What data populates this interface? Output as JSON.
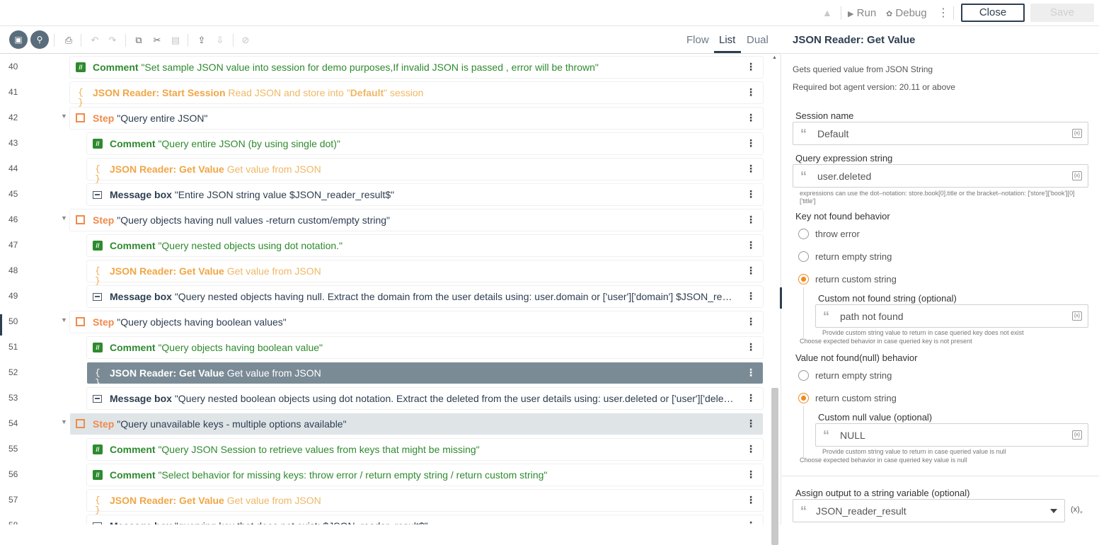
{
  "header": {
    "run_label": "Run",
    "debug_label": "Debug",
    "close_label": "Close",
    "save_label": "Save"
  },
  "view_tabs": [
    "Flow",
    "List",
    "Dual"
  ],
  "active_view": "List",
  "rows": [
    {
      "n": "40",
      "indent": 0,
      "kind": "cmt",
      "kw": "Comment",
      "text": " \"Set sample JSON value into session for demo purposes,If invalid JSON is passed , error will be thrown\""
    },
    {
      "n": "41",
      "indent": 0,
      "kind": "json",
      "kw": "JSON Reader: Start Session",
      "text": " Read JSON and store into \"",
      "bold": "Default",
      "tail": "\" session"
    },
    {
      "n": "42",
      "indent": 0,
      "kind": "step",
      "kw": "Step",
      "text": " \"Query entire JSON\"",
      "caret": true
    },
    {
      "n": "43",
      "indent": 1,
      "kind": "cmt",
      "kw": "Comment",
      "text": " \"Query entire JSON (by using single dot)\""
    },
    {
      "n": "44",
      "indent": 1,
      "kind": "json",
      "kw": "JSON Reader: Get Value",
      "text": " Get value from JSON"
    },
    {
      "n": "45",
      "indent": 1,
      "kind": "msg",
      "kw": "Message box",
      "text": " \"Entire JSON string value $JSON_reader_result$\""
    },
    {
      "n": "46",
      "indent": 0,
      "kind": "step",
      "kw": "Step",
      "text": " \"Query objects having null values -return custom/empty string\"",
      "caret": true
    },
    {
      "n": "47",
      "indent": 1,
      "kind": "cmt",
      "kw": "Comment",
      "text": " \"Query nested objects using dot notation.\""
    },
    {
      "n": "48",
      "indent": 1,
      "kind": "json",
      "kw": "JSON Reader: Get Value",
      "text": " Get value from JSON"
    },
    {
      "n": "49",
      "indent": 1,
      "kind": "msg",
      "kw": "Message box",
      "text": " \"Query nested objects having null. Extract the domain from the user details using: user.domain or ['user']['domain'] $JSON_reader_result$\""
    },
    {
      "n": "50",
      "indent": 0,
      "kind": "step",
      "kw": "Step",
      "text": " \"Query objects having boolean values\"",
      "caret": true
    },
    {
      "n": "51",
      "indent": 1,
      "kind": "cmt",
      "kw": "Comment",
      "text": " \"Query objects having boolean value\""
    },
    {
      "n": "52",
      "indent": 1,
      "kind": "json",
      "kw": "JSON Reader: Get Value",
      "text": " Get value from JSON",
      "selected": true
    },
    {
      "n": "53",
      "indent": 1,
      "kind": "msg",
      "kw": "Message box",
      "text": " \"Query nested boolean objects using dot notation. Extract the deleted from the user details using: user.deleted or ['user']['deleted'] $JSON_reader_result$\""
    },
    {
      "n": "54",
      "indent": 0,
      "kind": "step",
      "kw": "Step",
      "text": " \"Query unavailable keys - multiple options available\"",
      "caret": true,
      "highlight": true
    },
    {
      "n": "55",
      "indent": 1,
      "kind": "cmt",
      "kw": "Comment",
      "text": " \"Query JSON Session to retrieve values from keys that might be missing\""
    },
    {
      "n": "56",
      "indent": 1,
      "kind": "cmt",
      "kw": "Comment",
      "text": " \"Select behavior for missing keys: throw error / return empty string / return custom string\""
    },
    {
      "n": "57",
      "indent": 1,
      "kind": "json",
      "kw": "JSON Reader: Get Value",
      "text": " Get value from JSON"
    },
    {
      "n": "58",
      "indent": 1,
      "kind": "msg",
      "kw": "Message box",
      "text": " \"querying key that does not exist: $JSON_reader_result$\""
    }
  ],
  "panel": {
    "title": "JSON Reader: Get Value",
    "desc": "Gets queried value from JSON String",
    "version": "Required bot agent version: 20.11 or above",
    "session_label": "Session name",
    "session_value": "Default",
    "query_label": "Query expression string",
    "query_value": "user.deleted",
    "query_help": "expressions can use the dot–notation: store.book[0].title or the bracket–notation: ['store']['book'][0]['title']",
    "key_label": "Key not found behavior",
    "key_options": [
      "throw error",
      "return empty string",
      "return custom string"
    ],
    "key_selected": "return custom string",
    "custom_nf_label": "Custom not found string (optional)",
    "custom_nf_value": "path not found",
    "custom_nf_help": "Provide custom string value to return in case queried key does not exist",
    "key_help": "Choose expected behavior in case queried key is not present",
    "null_label": "Value not found(null) behavior",
    "null_options": [
      "return empty string",
      "return custom string"
    ],
    "null_selected": "return custom string",
    "custom_null_label": "Custom null value (optional)",
    "custom_null_value": "NULL",
    "custom_null_help": "Provide custom string value to return in case queried value is null",
    "null_help": "Choose expected behavior in case queried key value is null",
    "assign_label": "Assign output to a string variable (optional)",
    "assign_value": "JSON_reader_result"
  }
}
